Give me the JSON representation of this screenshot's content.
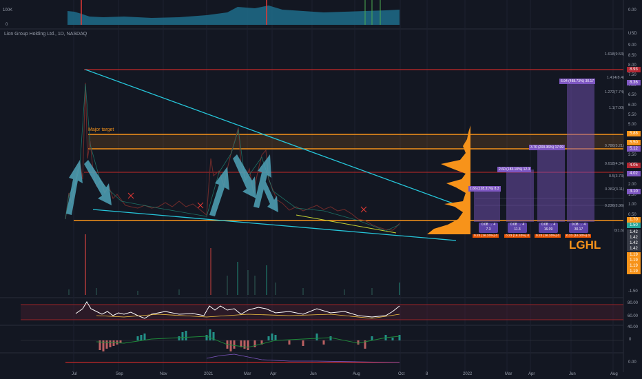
{
  "symbol_line": "Lion Group Holding Ltd., 1D, NASDAQ",
  "logo": "LGHL",
  "major_target": "Major target",
  "currency": "USD",
  "top_pane": {
    "left_top": "100K",
    "left_bottom": "0",
    "right_top": "0.00"
  },
  "price_axis": [
    "9.00",
    "8.50",
    "8.00",
    "7.50",
    "7.00",
    "6.50",
    "6.00",
    "5.50",
    "5.00",
    "4.50",
    "4.00",
    "3.50",
    "3.00",
    "2.50",
    "2.00",
    "1.50",
    "1.00",
    "0.50",
    "0.00",
    "-0.50",
    "-1.00",
    "-1.50"
  ],
  "price_tags": [
    {
      "text": "8.93",
      "color": "#b22833"
    },
    {
      "text": "8.36",
      "color": "#7e57c2"
    },
    {
      "text": "5.88",
      "color": "#f7931a"
    },
    {
      "text": "5.50",
      "color": "#f7931a"
    },
    {
      "text": "5.12",
      "color": "#7e57c2"
    },
    {
      "text": "4.05",
      "color": "#b22833"
    },
    {
      "text": "4.02",
      "color": "#7e57c2"
    },
    {
      "text": "3.10",
      "color": "#7e57c2"
    },
    {
      "text": "1.70",
      "color": "#f7931a"
    },
    {
      "text": "1.50",
      "color": "#26a69a"
    },
    {
      "text": "1.42",
      "color": "#363a45"
    },
    {
      "text": "1.42",
      "color": "#363a45"
    },
    {
      "text": "1.42",
      "color": "#363a45"
    },
    {
      "text": "1.42",
      "color": "#363a45"
    },
    {
      "text": "1.19",
      "color": "#f7931a"
    },
    {
      "text": "1.19",
      "color": "#f7931a"
    },
    {
      "text": "1.19",
      "color": "#f7931a"
    },
    {
      "text": "1.19",
      "color": "#f7931a"
    }
  ],
  "fib_labels": [
    "1.618(9.53)",
    "1.414(8.4)",
    "1.272(7.74)",
    "1.1(7.00)",
    "0.786(5.21)",
    "0.618(4.34)",
    "0.5(3.73)",
    "0.382(3.11)",
    "0.236(2.36)",
    "0(1.6)"
  ],
  "projections": [
    {
      "text": "6.94 (488.73%) 30.17",
      "color": "#7e57c2"
    },
    {
      "text": "3.70 (200.36%) 17.09",
      "color": "#7e57c2"
    },
    {
      "text": "2.60 (183.10%) 12.3",
      "color": "#7e57c2"
    },
    {
      "text": "1.66 (128.31%) 8.3",
      "color": "#7e57c2"
    }
  ],
  "range_boxes": [
    {
      "top": "0.08 → 4",
      "bottom": "7.3"
    },
    {
      "top": "0.08 → 4",
      "bottom": "11.3"
    },
    {
      "top": "0.08 → 4",
      "bottom": "16.09"
    },
    {
      "top": "0.08 → 4",
      "bottom": "30.17"
    }
  ],
  "loss_labels": [
    "0.23 (16.20%) 0",
    "0.23 (16.20%) 0",
    "0.23 (16.20%) 0",
    "0.23 (16.20%) 0"
  ],
  "rsi_axis": [
    "80.00",
    "60.00",
    "40.00"
  ],
  "macd_axis": [
    "0"
  ],
  "bottom_axis": [
    "0.00"
  ],
  "time_axis": [
    "Jul",
    "Sep",
    "Nov",
    "2021",
    "Mar",
    "Apr",
    "Jun",
    "Aug",
    "Oct",
    "8",
    "2022",
    "Mar",
    "Apr",
    "Jun",
    "Aug"
  ]
}
